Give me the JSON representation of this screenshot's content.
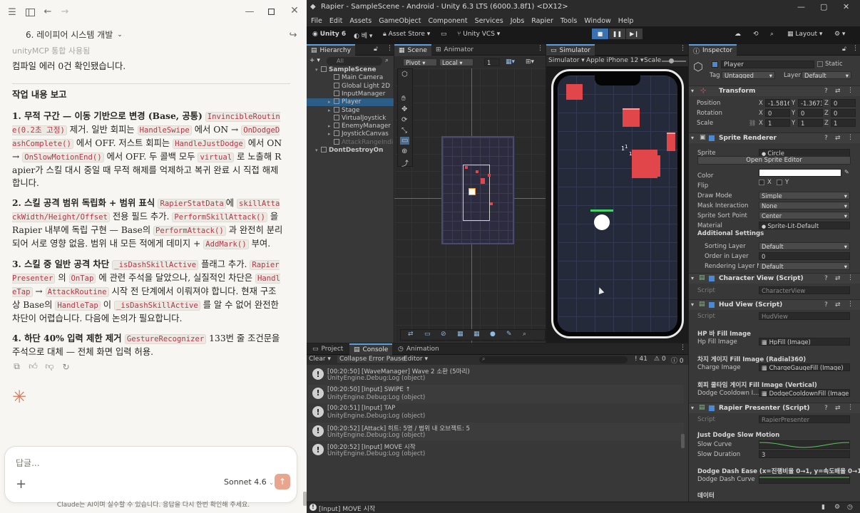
{
  "claude": {
    "conv_title": "6. 레이피어 시스템 개발",
    "faded_header": "unityMCP 통합 사용됨",
    "compile_msg": "컴파일 에러 0건 확인됐습니다.",
    "section_title": "작업 내용 보고",
    "p1": {
      "title": "1. 무적 구간 — 이동 기반으로 변경 (Base, 공통)",
      "code1": "InvincibleRoutine(0.2초 고정)",
      "t1": " 제거. 일반 회피는 ",
      "code2": "HandleSwipe",
      "t2": " 에서 ON → ",
      "code3": "OnDodgeDashComplete()",
      "t3": " 에서 OFF. 저스트 회피는 ",
      "code4": "HandleJustDodge",
      "t4": " 에서 ON → ",
      "code5": "OnSlowMotionEnd()",
      "t5": " 에서 OFF. 두 콜백 모두 ",
      "code6": "virtual",
      "t6": " 로 노출해 Rapier가 스킬 대시 중일 때 무적 해제를 억제하고 복귀 완료 시 직접 해제합니다."
    },
    "p2": {
      "title": "2. 스킬 공격 범위 독립화 + 범위 표식 ",
      "code1": "RapierStatData",
      "t1": "에 ",
      "code2": "skillAttackWidth/Height/Offset",
      "t2": " 전용 필드 추가. ",
      "code3": "PerformSkillAttack()",
      "t3": " 을 Rapier 내부에 독립 구현 — Base의 ",
      "code4": "PerformAttack()",
      "t4": " 과 완전히 분리되어 서로 영향 없음. 범위 내 모든 적에게 데미지 + ",
      "code5": "AddMark()",
      "t5": " 부여."
    },
    "p3": {
      "title": "3. 스킬 중 일반 공격 차단 ",
      "code1": "_isDashSkillActive",
      "t1": " 플래그 추가. ",
      "code2": "RapierPresenter",
      "t2": " 의 ",
      "code3": "OnTap",
      "t3": " 에 관련 주석을 달았으나, 실질적인 차단은 ",
      "code4": "HandleTap",
      "t4": " → ",
      "code5": "AttackRoutine",
      "t5": " 시작 전 단계에서 이뤄져야 합니다. 현재 구조상 Base의 ",
      "code6": "HandleTap",
      "t6": " 이 ",
      "code7": "_isDashSkillActive",
      "t7": " 를 알 수 없어 완전한 차단이 어렵습니다. 다음에 논의가 필요합니다."
    },
    "p4": {
      "title": "4. 하단 40% 입력 제한 제거 ",
      "code1": "GestureRecognizer",
      "t1": " 133번 줄 조건문을 주석으로 대체 — 전체 화면 입력 허용."
    },
    "input_placeholder": "답글...",
    "model": "Sonnet 4.6",
    "disclaimer": "Claude는 AI이며 실수할 수 있습니다. 응답을 다시 한번 확인해 주세요."
  },
  "unity": {
    "window_title": "Rapier - SampleScene - Android - Unity 6.3 LTS (6000.3.8f1) <DX12>",
    "menu": [
      "File",
      "Edit",
      "Assets",
      "GameObject",
      "Component",
      "Services",
      "Jobs",
      "Rapier",
      "Tools",
      "Window",
      "Help"
    ],
    "toolbar": {
      "account": "Unity 6",
      "beta": "베",
      "asset_store": "Asset Store",
      "vcs": "Unity VCS",
      "layout": "Layout"
    },
    "tabs": {
      "hierarchy": "Hierarchy",
      "scene": "Scene",
      "animator": "Animator",
      "simulator": "Simulator",
      "inspector": "Inspector",
      "project": "Project",
      "console": "Console",
      "animation": "Animation"
    },
    "hierarchy": {
      "search": "All",
      "items": [
        {
          "label": "SampleScene",
          "indent": 0,
          "kind": "scene"
        },
        {
          "label": "Main Camera",
          "indent": 2,
          "kind": "obj"
        },
        {
          "label": "Global Light 2D",
          "indent": 2,
          "kind": "obj"
        },
        {
          "label": "InputManager",
          "indent": 2,
          "kind": "obj"
        },
        {
          "label": "Player",
          "indent": 2,
          "kind": "sel"
        },
        {
          "label": "Stage",
          "indent": 2,
          "kind": "obj"
        },
        {
          "label": "VirtualJoystick",
          "indent": 2,
          "kind": "obj"
        },
        {
          "label": "EnemyManager",
          "indent": 2,
          "kind": "obj"
        },
        {
          "label": "JoystickCanvas",
          "indent": 2,
          "kind": "obj"
        },
        {
          "label": "AttackRangeIndi",
          "indent": 2,
          "kind": "dim"
        },
        {
          "label": "DontDestroyOn",
          "indent": 0,
          "kind": "scene"
        }
      ]
    },
    "scene_toolbar": {
      "pivot": "Pivot",
      "local": "Local",
      "grid_value": "1"
    },
    "simulator_toolbar": {
      "mode": "Simulator",
      "device": "Apple iPhone 12",
      "scale": "Scale"
    },
    "sim_labels": [
      "1",
      "1",
      "1"
    ],
    "console": {
      "clear": "Clear",
      "collapse": "Collapse",
      "error_pause": "Error Pause",
      "editor": "Editor",
      "count_log": "41",
      "count_warn": "0",
      "count_err": "0",
      "logs": [
        {
          "line1": "[00:20:50] [WaveManager] Wave 2 소환 (5마리)",
          "line2": "UnityEngine.Debug:Log (object)"
        },
        {
          "line1": "[00:20:50] [Input] SWIPE ↑",
          "line2": "UnityEngine.Debug:Log (object)"
        },
        {
          "line1": "[00:20:51] [Input] TAP",
          "line2": "UnityEngine.Debug:Log (object)"
        },
        {
          "line1": "[00:20:52] [Attack] 히트: 5명 / 범위 내 오브젝트: 5",
          "line2": "UnityEngine.Debug:Log (object)"
        },
        {
          "line1": "[00:20:52] [Input] MOVE 시작",
          "line2": "UnityEngine.Debug:Log (object)"
        }
      ]
    },
    "status_text": "[Input] MOVE 시작",
    "inspector": {
      "name": "Player",
      "static": "Static",
      "tag_lbl": "Tag",
      "tag": "Untagged",
      "layer_lbl": "Layer",
      "layer": "Default",
      "transform": {
        "title": "Transform",
        "position_lbl": "Position",
        "rotation_lbl": "Rotation",
        "scale_lbl": "Scale",
        "position": [
          "-1.5816",
          "-1.3673",
          "0"
        ],
        "rotation": [
          "0",
          "0",
          "0"
        ],
        "scale": [
          "1",
          "1",
          "1"
        ]
      },
      "sprite_renderer": {
        "title": "Sprite Renderer",
        "sprite_lbl": "Sprite",
        "sprite": "Circle",
        "open_editor": "Open Sprite Editor",
        "color_lbl": "Color",
        "flip_lbl": "Flip",
        "flip_x": "X",
        "flip_y": "Y",
        "draw_mode_lbl": "Draw Mode",
        "draw_mode": "Simple",
        "mask_lbl": "Mask Interaction",
        "mask": "None",
        "sort_point_lbl": "Sprite Sort Point",
        "sort_point": "Center",
        "material_lbl": "Material",
        "material": "Sprite-Lit-Default",
        "additional": "Additional Settings",
        "sorting_layer_lbl": "Sorting Layer",
        "sorting_layer": "Default",
        "order_lbl": "Order in Layer",
        "order": "0",
        "rendering_layer_lbl": "Rendering Layer M",
        "rendering_layer": "Default"
      },
      "character_view": {
        "title": "Character View (Script)",
        "script_lbl": "Script",
        "script": "CharacterView"
      },
      "hud_view": {
        "title": "Hud View (Script)",
        "script_lbl": "Script",
        "script": "HudView",
        "hp_sect": "HP 바 Fill Image",
        "hp_lbl": "Hp Fill Image",
        "hp": "HpFill (Image)",
        "charge_sect": "차지 게이지 Fill Image (Radial360)",
        "charge_lbl": "Charge Image",
        "charge": "ChargeGaugeFill (Image)",
        "dodge_sect": "회피 쿨타임 게이지 Fill Image (Vertical)",
        "dodge_lbl": "Dodge Cooldown I...",
        "dodge": "DodgeCooldownFill (Image)"
      },
      "rapier_presenter": {
        "title": "Rapier Presenter (Script)",
        "script_lbl": "Script",
        "script": "RapierPresenter",
        "slow_sect": "Just Dodge Slow Motion",
        "slow_curve_lbl": "Slow Curve",
        "slow_dur_lbl": "Slow Duration",
        "slow_dur": "3",
        "dash_sect": "Dodge Dash Ease (x=진행비율 0→1, y=속도배율 0→1)",
        "dash_curve_lbl": "Dodge Dash Curve",
        "data_sect": "데이터"
      }
    }
  }
}
